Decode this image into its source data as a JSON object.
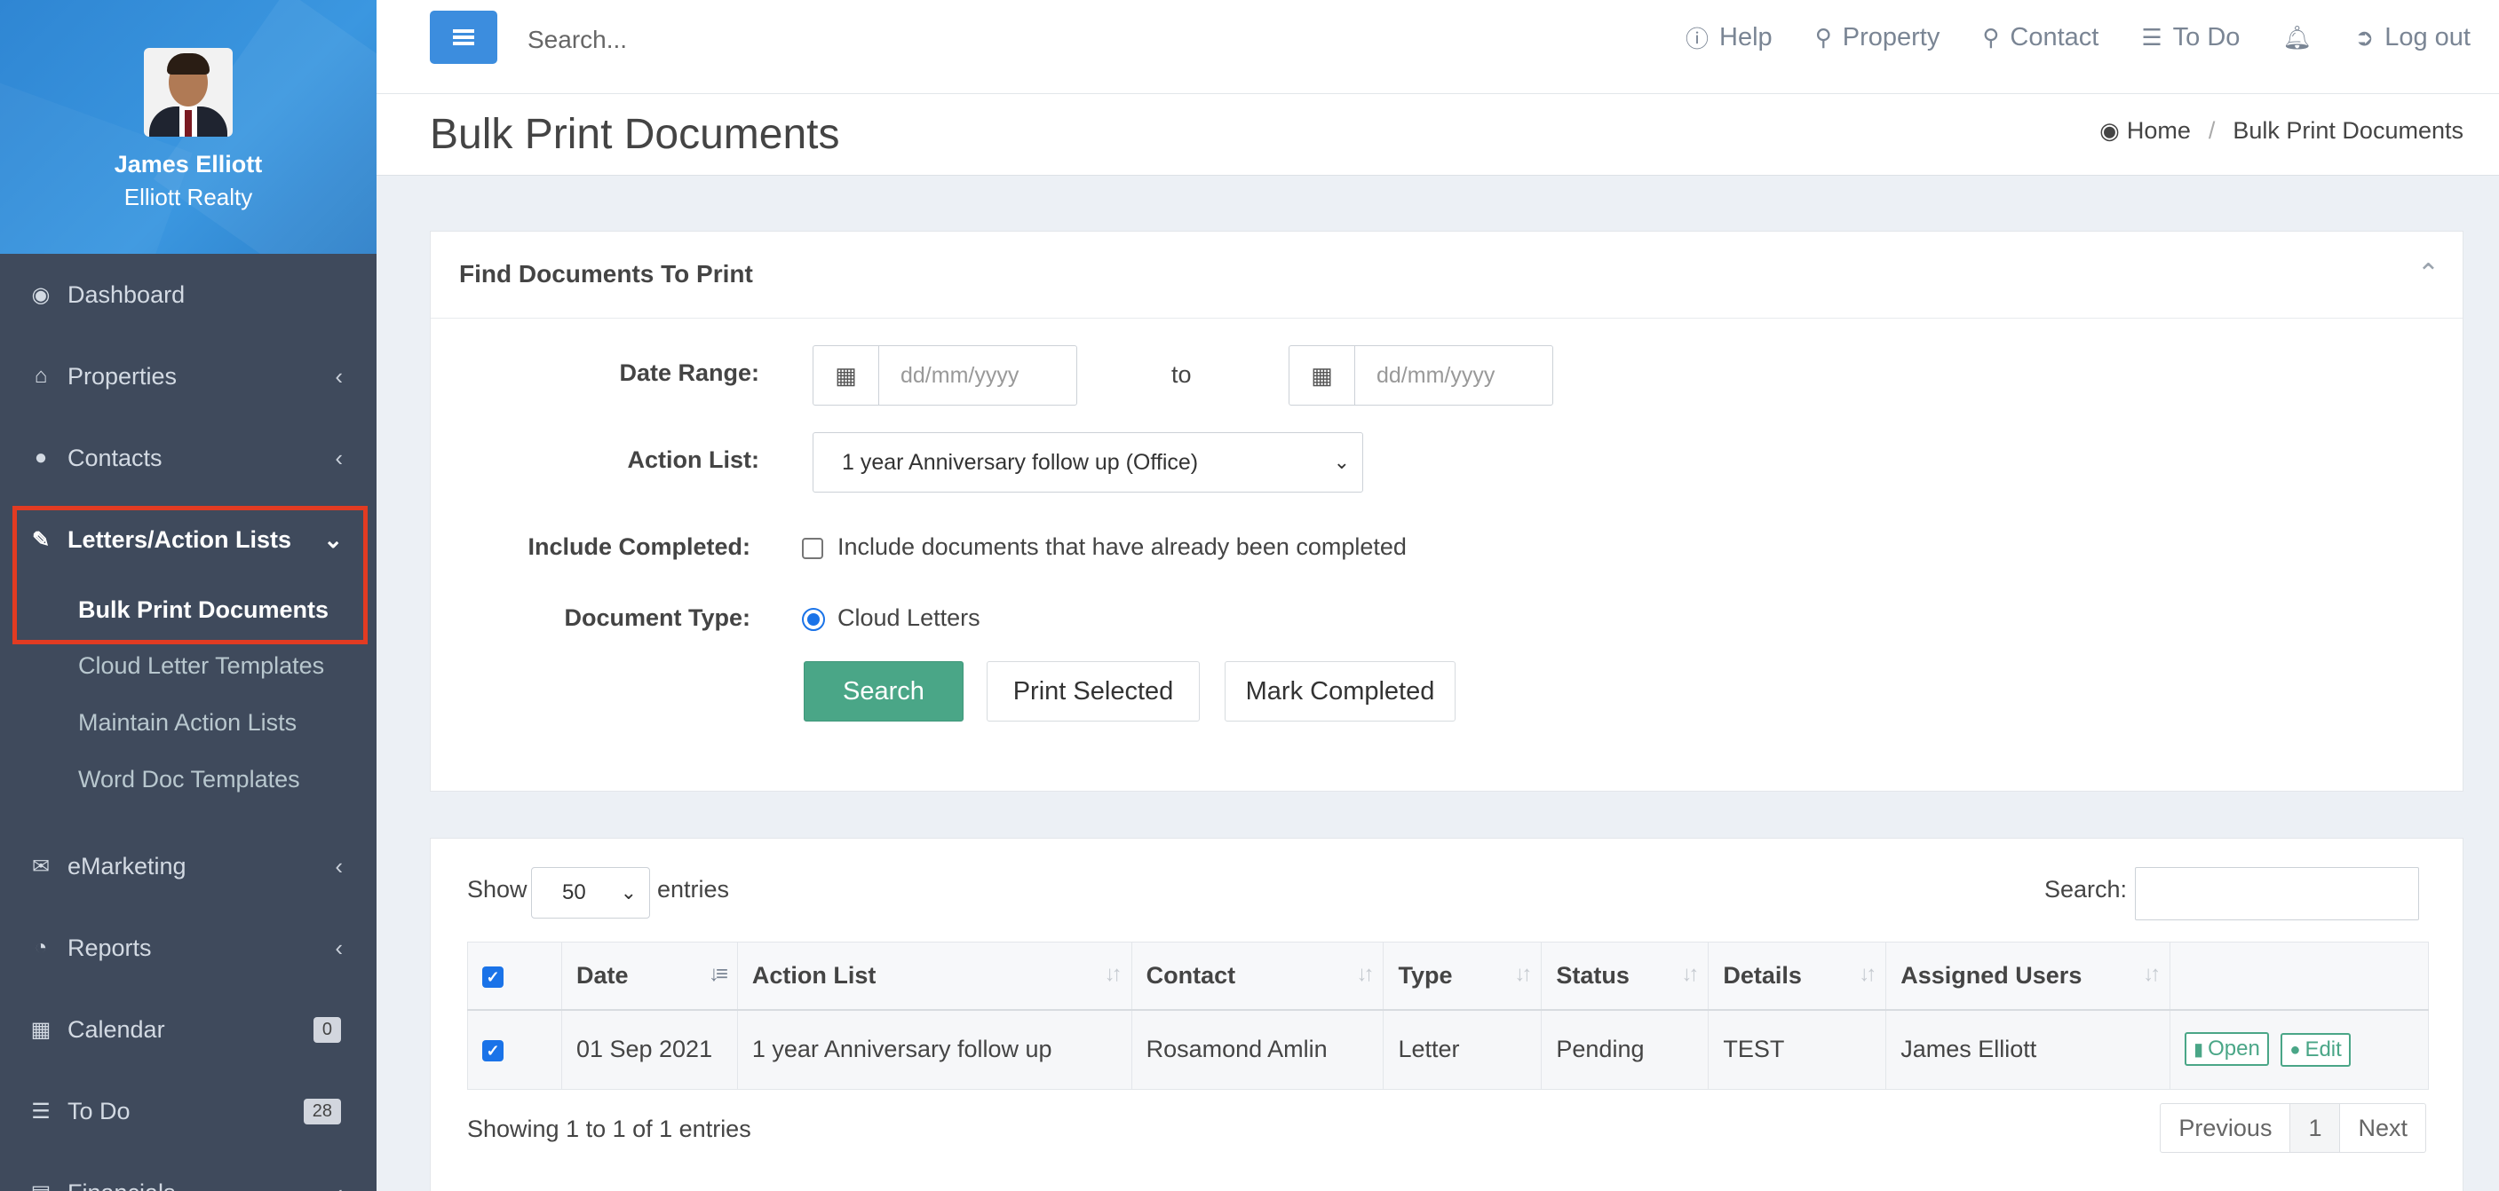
{
  "user": {
    "name": "James Elliott",
    "company": "Elliott Realty"
  },
  "sidebar": {
    "items": [
      {
        "label": "Dashboard",
        "icon": "dashboard-icon"
      },
      {
        "label": "Properties",
        "icon": "home-icon"
      },
      {
        "label": "Contacts",
        "icon": "user-icon"
      },
      {
        "label": "Letters/Action Lists",
        "icon": "edit-icon"
      },
      {
        "label": "eMarketing",
        "icon": "envelope-icon"
      },
      {
        "label": "Reports",
        "icon": "pie-chart-icon"
      },
      {
        "label": "Calendar",
        "icon": "calendar-icon",
        "badge": "0"
      },
      {
        "label": "To Do",
        "icon": "list-icon",
        "badge": "28"
      },
      {
        "label": "Financials",
        "icon": "money-icon"
      }
    ],
    "subitems": [
      "Bulk Print Documents",
      "Cloud Letter Templates",
      "Maintain Action Lists",
      "Word Doc Templates"
    ]
  },
  "topbar": {
    "search_placeholder": "Search...",
    "links": [
      "Help",
      "Property",
      "Contact",
      "To Do",
      "Log out"
    ]
  },
  "page": {
    "title": "Bulk Print Documents",
    "breadcrumb": [
      "Home",
      "Bulk Print Documents"
    ]
  },
  "form": {
    "panel_title": "Find Documents To Print",
    "date_range_label": "Date Range:",
    "date_placeholder": "dd/mm/yyyy",
    "to_label": "to",
    "action_list_label": "Action List:",
    "action_list_value": "1 year Anniversary follow up (Office)",
    "include_completed_label": "Include Completed:",
    "include_completed_text": "Include documents that have already been completed",
    "document_type_label": "Document Type:",
    "document_type_option": "Cloud Letters",
    "buttons": {
      "search": "Search",
      "print": "Print Selected",
      "mark": "Mark Completed"
    }
  },
  "table": {
    "show_label": "Show",
    "entries_value": "50",
    "entries_label": "entries",
    "search_label": "Search:",
    "columns": [
      "Date",
      "Action List",
      "Contact",
      "Type",
      "Status",
      "Details",
      "Assigned Users"
    ],
    "rows": [
      {
        "date": "01 Sep 2021",
        "action_list": "1 year Anniversary follow up",
        "contact": "Rosamond Amlin",
        "type": "Letter",
        "status": "Pending",
        "details": "TEST",
        "assigned": "James Elliott",
        "open_label": "Open",
        "edit_label": "Edit"
      }
    ],
    "info": "Showing 1 to 1 of 1 entries",
    "pagination": {
      "previous": "Previous",
      "page": "1",
      "next": "Next"
    }
  },
  "colors": {
    "sidebar": "#3f4a5c",
    "accent_blue": "#3c8dde",
    "success": "#4aa687",
    "highlight": "#e23b22"
  }
}
